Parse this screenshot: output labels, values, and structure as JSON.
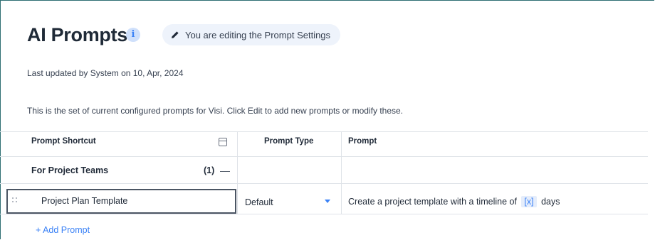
{
  "header": {
    "title": "AI Prompts",
    "info_icon_glyph": "i",
    "edit_chip_label": "You are editing the Prompt Settings"
  },
  "meta": {
    "last_updated": "Last updated by System on 10, Apr, 2024",
    "description": "This is the set of current configured prompts for Visi. Click Edit to add new prompts or modify these."
  },
  "table": {
    "columns": [
      "Prompt Shortcut",
      "Prompt Type",
      "Prompt"
    ],
    "group": {
      "label": "For Project Teams",
      "count": "(1)",
      "collapse_glyph": "—"
    },
    "rows": [
      {
        "shortcut": "Project Plan Template",
        "type": "Default",
        "prompt_before": "Create a project template with a timeline of",
        "prompt_var": "[x]",
        "prompt_after": "days"
      }
    ],
    "add_prompt_label": "+ Add Prompt"
  },
  "colors": {
    "accent": "#3b82f6",
    "frame_border": "#2f6f73",
    "chip_bg": "#eef3fb"
  },
  "icons": [
    "info-icon",
    "pencil-icon",
    "column-toggle-icon",
    "drag-handle-icon",
    "dropdown-caret-icon"
  ]
}
